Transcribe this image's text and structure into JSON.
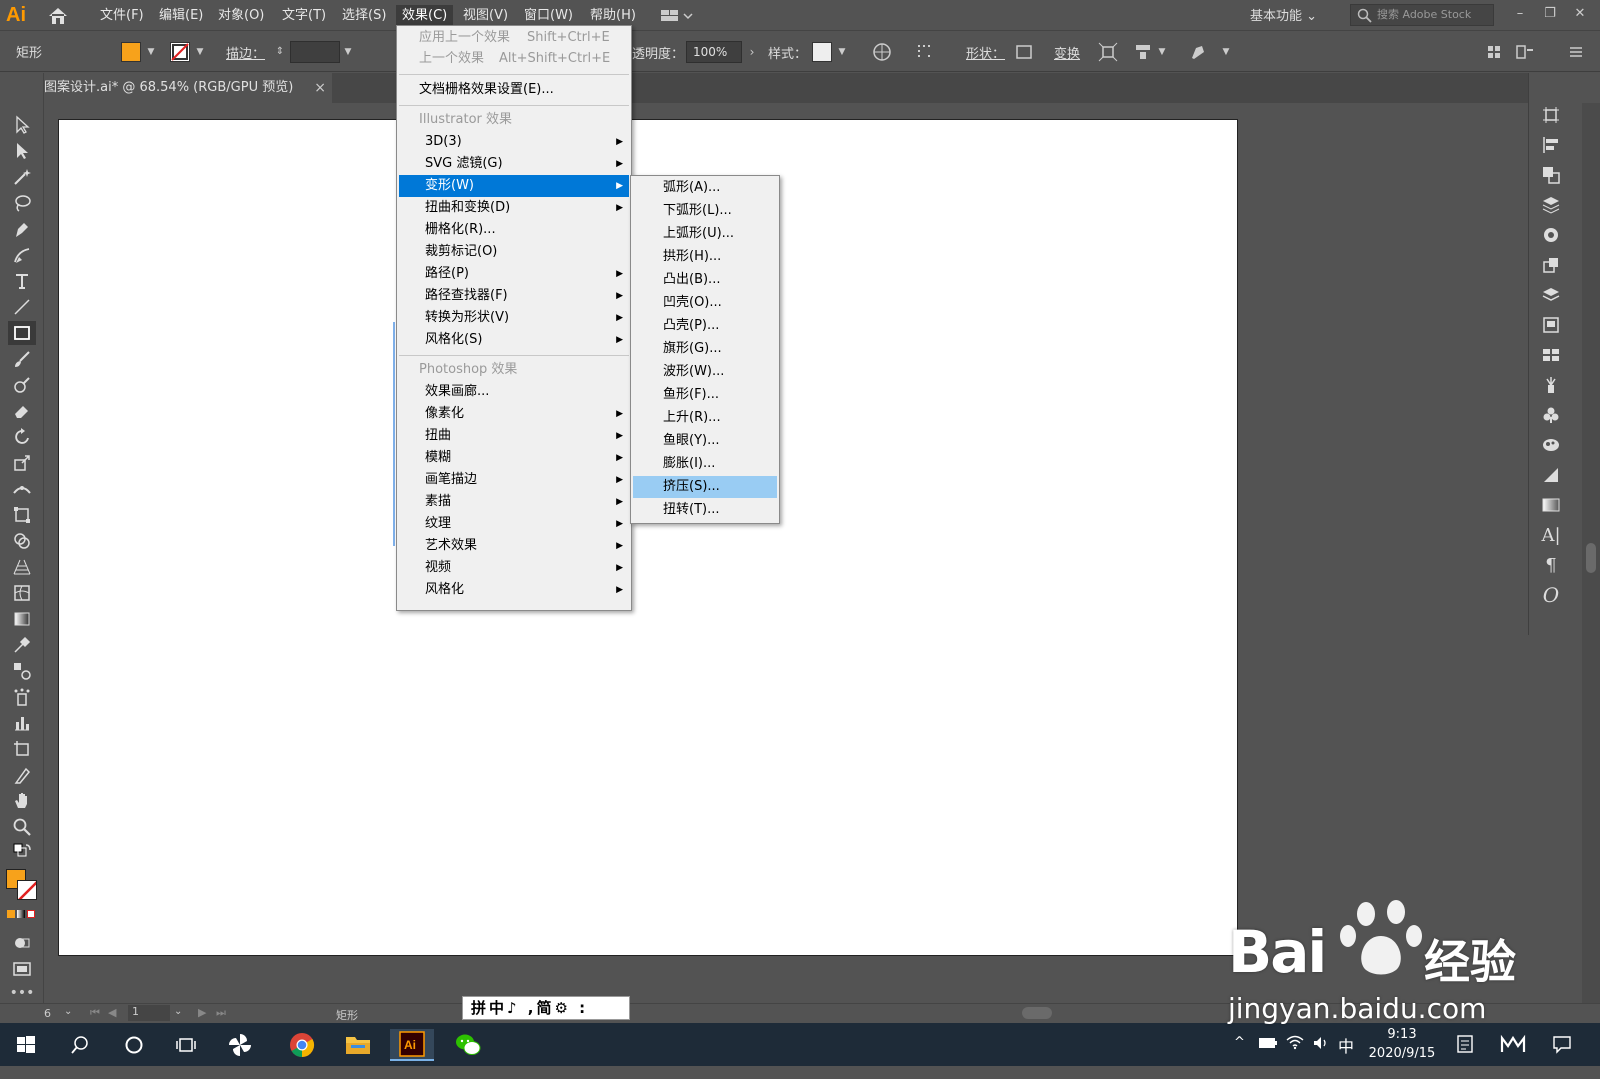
{
  "app": {
    "logo": "Ai"
  },
  "menubar": {
    "items": [
      "文件(F)",
      "编辑(E)",
      "对象(O)",
      "文字(T)",
      "选择(S)",
      "效果(C)",
      "视图(V)",
      "窗口(W)",
      "帮助(H)"
    ],
    "workspace": "基本功能",
    "stock_search_placeholder": "搜索 Adobe Stock"
  },
  "controlbar": {
    "object_type": "矩形",
    "fill_color": "#f7a21b",
    "stroke_label": "描边：",
    "opacity_label": "透明度：",
    "opacity_value": "100%",
    "style_label": "样式：",
    "shape_label": "形状：",
    "transform_label": "变换"
  },
  "document": {
    "tab_title": "图案设计.ai* @ 68.54% (RGB/GPU 预览)",
    "close": "×"
  },
  "effect_menu": {
    "items": [
      {
        "label": "应用上一个效果",
        "shortcut": "Shift+Ctrl+E",
        "disabled": true
      },
      {
        "label": "上一个效果",
        "shortcut": "Alt+Shift+Ctrl+E",
        "disabled": true
      },
      {
        "label": "文档栅格效果设置(E)..."
      },
      {
        "header": "Illustrator 效果"
      },
      {
        "label": "3D(3)",
        "submenu": true
      },
      {
        "label": "SVG 滤镜(G)",
        "submenu": true
      },
      {
        "label": "变形(W)",
        "submenu": true,
        "highlighted": true
      },
      {
        "label": "扭曲和变换(D)",
        "submenu": true
      },
      {
        "label": "栅格化(R)..."
      },
      {
        "label": "裁剪标记(O)"
      },
      {
        "label": "路径(P)",
        "submenu": true
      },
      {
        "label": "路径查找器(F)",
        "submenu": true
      },
      {
        "label": "转换为形状(V)",
        "submenu": true
      },
      {
        "label": "风格化(S)",
        "submenu": true
      },
      {
        "header": "Photoshop 效果"
      },
      {
        "label": "效果画廊..."
      },
      {
        "label": "像素化",
        "submenu": true
      },
      {
        "label": "扭曲",
        "submenu": true
      },
      {
        "label": "模糊",
        "submenu": true
      },
      {
        "label": "画笔描边",
        "submenu": true
      },
      {
        "label": "素描",
        "submenu": true
      },
      {
        "label": "纹理",
        "submenu": true
      },
      {
        "label": "艺术效果",
        "submenu": true
      },
      {
        "label": "视频",
        "submenu": true
      },
      {
        "label": "风格化",
        "submenu": true
      }
    ]
  },
  "warp_submenu": {
    "items": [
      "弧形(A)...",
      "下弧形(L)...",
      "上弧形(U)...",
      "拱形(H)...",
      "凸出(B)...",
      "凹壳(O)...",
      "凸壳(P)...",
      "旗形(G)...",
      "波形(W)...",
      "鱼形(F)...",
      "上升(R)...",
      "鱼眼(Y)...",
      "膨胀(I)...",
      "挤压(S)...",
      "扭转(T)..."
    ],
    "hovered": "挤压(S)..."
  },
  "statusbar": {
    "artboard_number": "1",
    "tool_name": "矩形",
    "zoom_fragment": "6"
  },
  "ime": {
    "text": "拼中♪ ,简⚙ :"
  },
  "taskbar": {
    "ime_indicator": "中",
    "time": "9:13",
    "date": "2020/9/15"
  },
  "watermark": {
    "main": "Bai",
    "cn": "经验",
    "sub": "jingyan.baidu.com"
  }
}
